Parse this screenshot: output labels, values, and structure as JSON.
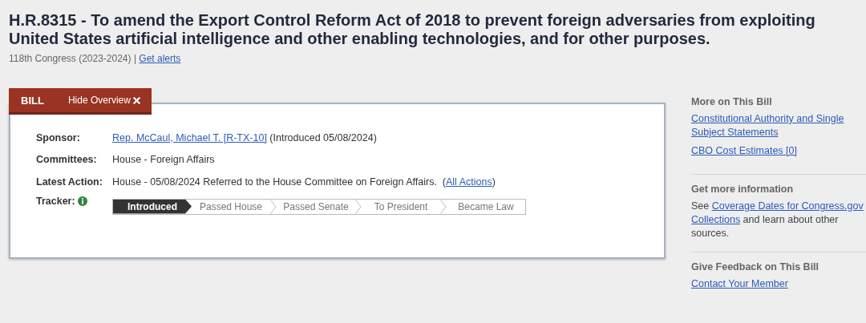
{
  "title": "H.R.8315 - To amend the Export Control Reform Act of 2018 to prevent foreign adversaries from exploiting United States artificial intelligence and other enabling technologies, and for other purposes.",
  "subtitle": {
    "congress": "118th Congress (2023-2024) |",
    "link": "Get alerts"
  },
  "tabs": [
    {
      "label": "BILL",
      "kind": "label"
    },
    {
      "label": "Hide Overview",
      "kind": "toggle"
    }
  ],
  "overview": {
    "rows": [
      {
        "label": "Sponsor:",
        "parts": [
          {
            "text": "Rep. McCaul, Michael T. [R-TX-10]",
            "kind": "link"
          },
          {
            "text": " (Introduced 05/08/2024)",
            "kind": "text"
          }
        ]
      },
      {
        "label": "Committees:",
        "parts": [
          {
            "text": "House - Foreign Affairs",
            "kind": "text"
          }
        ]
      },
      {
        "label": "Latest Action:",
        "parts": [
          {
            "text": "House - 05/08/2024 Referred to the House Committee on Foreign Affairs.  (",
            "kind": "text"
          },
          {
            "text": "All Actions",
            "kind": "link"
          },
          {
            "text": ")",
            "kind": "text"
          }
        ]
      }
    ],
    "tracker": {
      "label": "Tracker:",
      "steps": [
        {
          "label": "Introduced",
          "selected": true
        },
        {
          "label": "Passed House",
          "selected": false
        },
        {
          "label": "Passed Senate",
          "selected": false
        },
        {
          "label": "To President",
          "selected": false
        },
        {
          "label": "Became Law",
          "selected": false
        }
      ]
    }
  },
  "sidebar": [
    {
      "heading": "More on This Bill",
      "items": [
        {
          "kind": "link",
          "text": "Constitutional Authority and Single Subject Statements"
        },
        {
          "kind": "link",
          "text": "CBO Cost Estimates [0]"
        }
      ]
    },
    {
      "heading": "Get more information",
      "items": [
        {
          "kind": "sentence",
          "parts": [
            {
              "text": "See ",
              "kind": "text"
            },
            {
              "text": "Coverage Dates for Congress.gov",
              "kind": "link"
            },
            {
              "text": "Collections",
              "kind": "link"
            },
            {
              "text": " and learn about other sources.",
              "kind": "text"
            }
          ]
        }
      ]
    },
    {
      "heading": "Give Feedback on This Bill",
      "items": [
        {
          "kind": "link",
          "text": "Contact Your Member"
        }
      ]
    }
  ]
}
